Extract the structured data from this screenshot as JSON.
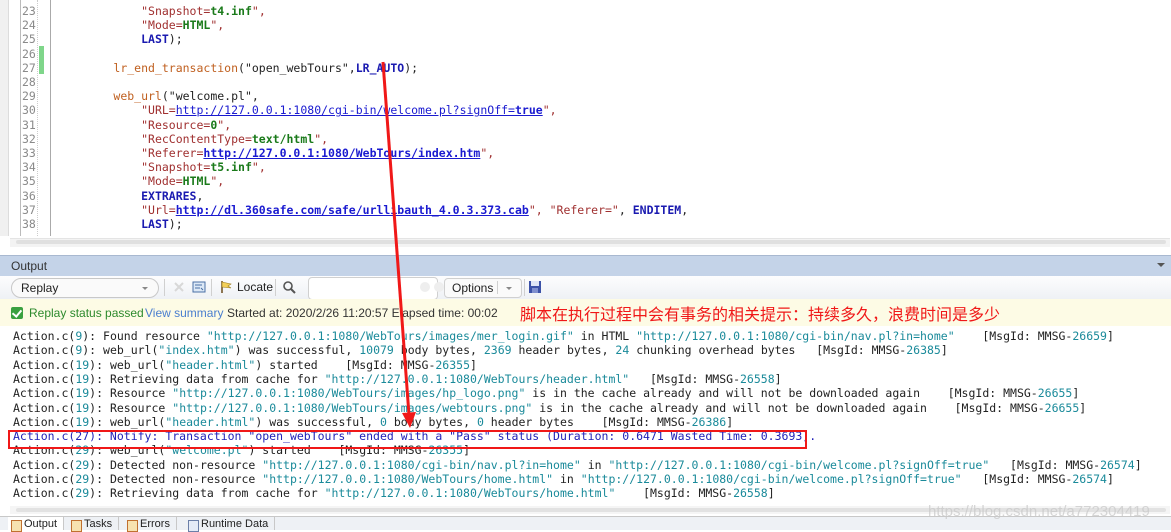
{
  "editor": {
    "lines": [
      {
        "num": "23",
        "parts": [
          {
            "t": "            "
          },
          {
            "t": "\"Snapshot=",
            "c": "str"
          },
          {
            "t": "t4.inf",
            "c": "val"
          },
          {
            "t": "\",",
            "c": "str"
          }
        ]
      },
      {
        "num": "24",
        "parts": [
          {
            "t": "            "
          },
          {
            "t": "\"Mode=",
            "c": "str"
          },
          {
            "t": "HTML",
            "c": "val"
          },
          {
            "t": "\",",
            "c": "str"
          }
        ]
      },
      {
        "num": "25",
        "parts": [
          {
            "t": "            "
          },
          {
            "t": "LAST",
            "c": "kw"
          },
          {
            "t": ");"
          }
        ]
      },
      {
        "num": "26",
        "parts": [
          {
            "t": ""
          }
        ]
      },
      {
        "num": "27",
        "parts": [
          {
            "t": "        "
          },
          {
            "t": "lr_end_transaction",
            "c": "fn"
          },
          {
            "t": "(\"open_webTours\","
          },
          {
            "t": "LR_AUTO",
            "c": "kw"
          },
          {
            "t": ");"
          }
        ]
      },
      {
        "num": "28",
        "parts": [
          {
            "t": ""
          }
        ]
      },
      {
        "num": "29",
        "parts": [
          {
            "t": "        "
          },
          {
            "t": "web_url",
            "c": "fn"
          },
          {
            "t": "(\"welcome.pl\","
          }
        ]
      },
      {
        "num": "30",
        "parts": [
          {
            "t": "            "
          },
          {
            "t": "\"URL=",
            "c": "str"
          },
          {
            "t": "http://127.0.0.1:1080/cgi-bin/welcome.pl?signOff=",
            "c": "url"
          },
          {
            "t": "true",
            "c": "urlb"
          },
          {
            "t": "\",",
            "c": "str"
          }
        ]
      },
      {
        "num": "31",
        "parts": [
          {
            "t": "            "
          },
          {
            "t": "\"Resource=",
            "c": "str"
          },
          {
            "t": "0",
            "c": "val"
          },
          {
            "t": "\",",
            "c": "str"
          }
        ]
      },
      {
        "num": "32",
        "parts": [
          {
            "t": "            "
          },
          {
            "t": "\"RecContentType=",
            "c": "str"
          },
          {
            "t": "text/html",
            "c": "val"
          },
          {
            "t": "\",",
            "c": "str"
          }
        ]
      },
      {
        "num": "33",
        "parts": [
          {
            "t": "            "
          },
          {
            "t": "\"Referer=",
            "c": "str"
          },
          {
            "t": "http://127.0.0.1:1080/WebTours/index.htm",
            "c": "urlb"
          },
          {
            "t": "\",",
            "c": "str"
          }
        ]
      },
      {
        "num": "34",
        "parts": [
          {
            "t": "            "
          },
          {
            "t": "\"Snapshot=",
            "c": "str"
          },
          {
            "t": "t5.inf",
            "c": "val"
          },
          {
            "t": "\",",
            "c": "str"
          }
        ]
      },
      {
        "num": "35",
        "parts": [
          {
            "t": "            "
          },
          {
            "t": "\"Mode=",
            "c": "str"
          },
          {
            "t": "HTML",
            "c": "val"
          },
          {
            "t": "\",",
            "c": "str"
          }
        ]
      },
      {
        "num": "36",
        "parts": [
          {
            "t": "            "
          },
          {
            "t": "EXTRARES",
            "c": "kw"
          },
          {
            "t": ","
          }
        ]
      },
      {
        "num": "37",
        "parts": [
          {
            "t": "            "
          },
          {
            "t": "\"Url=",
            "c": "str"
          },
          {
            "t": "http://dl.360safe.com/safe/urllibauth_4.0.3.373.cab",
            "c": "urlb"
          },
          {
            "t": "\", ",
            "c": "str"
          },
          {
            "t": "\"Referer=\"",
            "c": "str"
          },
          {
            "t": ", "
          },
          {
            "t": "ENDITEM",
            "c": "kw"
          },
          {
            "t": ","
          }
        ]
      },
      {
        "num": "38",
        "parts": [
          {
            "t": "            "
          },
          {
            "t": "LAST",
            "c": "kw"
          },
          {
            "t": ");"
          }
        ]
      }
    ]
  },
  "output": {
    "title": "Output",
    "toolbar": {
      "mode_select": "Replay",
      "locate_label": "Locate",
      "search_value": "",
      "options_label": "Options"
    },
    "status": {
      "passed_text": "Replay status passed",
      "view_summary": "View summary",
      "started_text": "Started at: 2020/2/26 11:20:57 Elapsed time: 00:02"
    },
    "annotation": "脚本在执行过程中会有事务的相关提示：持续多久，浪费时间是多少",
    "log": [
      "Action.c(9): Found resource \"http://127.0.0.1:1080/WebTours/images/mer_login.gif\" in HTML \"http://127.0.0.1:1080/cgi-bin/nav.pl?in=home\"    [MsgId: MMSG-26659]",
      "Action.c(9): web_url(\"index.htm\") was successful, 10079 body bytes, 2369 header bytes, 24 chunking overhead bytes   [MsgId: MMSG-26385]",
      "Action.c(19): web_url(\"header.html\") started    [MsgId: MMSG-26355]",
      "Action.c(19): Retrieving data from cache for \"http://127.0.0.1:1080/WebTours/header.html\"   [MsgId: MMSG-26558]",
      "Action.c(19): Resource \"http://127.0.0.1:1080/WebTours/images/hp_logo.png\" is in the cache already and will not be downloaded again    [MsgId: MMSG-26655]",
      "Action.c(19): Resource \"http://127.0.0.1:1080/WebTours/images/webtours.png\" is in the cache already and will not be downloaded again    [MsgId: MMSG-26655]",
      "Action.c(19): web_url(\"header.html\") was successful, 0 body bytes, 0 header bytes    [MsgId: MMSG-26386]",
      "Action.c(27): Notify: Transaction \"open_webTours\" ended with a \"Pass\" status (Duration: 0.6471 Wasted Time: 0.3693).",
      "Action.c(29): web_url(\"welcome.pl\") started    [MsgId: MMSG-26355]",
      "Action.c(29): Detected non-resource \"http://127.0.0.1:1080/cgi-bin/nav.pl?in=home\" in \"http://127.0.0.1:1080/cgi-bin/welcome.pl?signOff=true\"   [MsgId: MMSG-26574]",
      "Action.c(29): Detected non-resource \"http://127.0.0.1:1080/WebTours/home.html\" in \"http://127.0.0.1:1080/cgi-bin/welcome.pl?signOff=true\"   [MsgId: MMSG-26574]",
      "Action.c(29): Retrieving data from cache for \"http://127.0.0.1:1080/WebTours/home.html\"    [MsgId: MMSG-26558]"
    ],
    "highlighted_index": 7
  },
  "tabs": [
    {
      "label": "Output",
      "icon": "output-icon",
      "active": true
    },
    {
      "label": "Tasks",
      "icon": "tasks-icon",
      "active": false
    },
    {
      "label": "Errors",
      "icon": "errors-icon",
      "active": false
    },
    {
      "label": "Runtime Data",
      "icon": "runtime-data-icon",
      "active": false
    }
  ],
  "watermark": "https://blog.csdn.net/a772304419",
  "colors": {
    "annotation": "#f01818",
    "output_header": "#c4d3e8",
    "status_bar": "#fdfbe5",
    "pass_green": "#2d8a2d"
  }
}
